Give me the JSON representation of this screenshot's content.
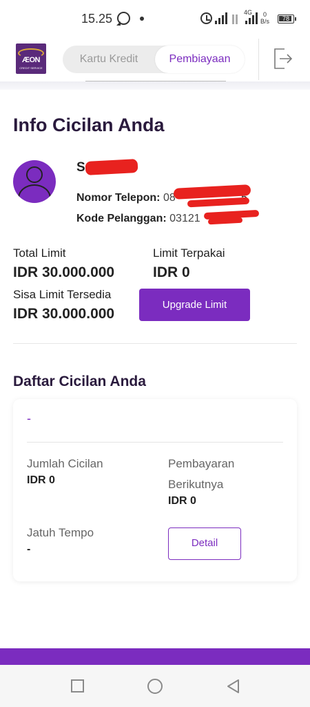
{
  "status_bar": {
    "time": "15.25",
    "network": "4G",
    "speed_value": "0",
    "speed_unit": "B/s",
    "battery": "78"
  },
  "header": {
    "logo_text": "ÆON",
    "logo_sub": "CREDIT SERVICE",
    "tabs": [
      {
        "label": "Kartu Kredit",
        "active": false
      },
      {
        "label": "Pembiayaan",
        "active": true
      }
    ],
    "logout_icon": "logout-icon"
  },
  "main": {
    "title": "Info Cicilan Anda",
    "user": {
      "name_visible": "S",
      "phone_label": "Nomor Telepon:",
      "phone_visible": "08",
      "phone_tail": "5",
      "customer_label": "Kode Pelanggan:",
      "customer_visible": "03121"
    },
    "limits": {
      "total_label": "Total Limit",
      "total_value": "IDR 30.000.000",
      "used_label": "Limit Terpakai",
      "used_value": "IDR 0",
      "remaining_label": "Sisa Limit Tersedia",
      "remaining_value": "IDR 30.000.000",
      "upgrade_label": "Upgrade Limit"
    },
    "installments": {
      "title": "Daftar Cicilan Anda",
      "card": {
        "name": "-",
        "amount_label": "Jumlah Cicilan",
        "amount_value": "IDR 0",
        "next_payment_label_1": "Pembayaran",
        "next_payment_label_2": "Berikutnya",
        "next_payment_value": "IDR 0",
        "due_label": "Jatuh Tempo",
        "due_value": "-",
        "detail_label": "Detail"
      }
    }
  },
  "colors": {
    "accent": "#7b2cbf",
    "title": "#2a1a3d",
    "redaction": "#e8221f"
  }
}
